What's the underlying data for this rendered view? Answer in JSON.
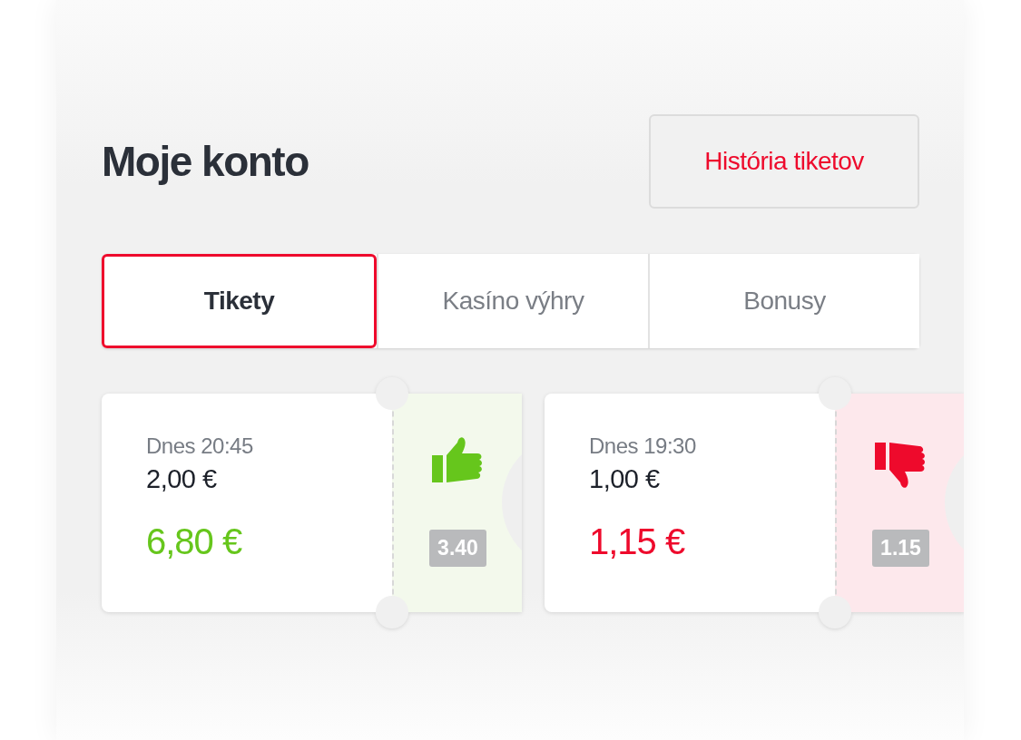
{
  "header": {
    "title": "Moje konto",
    "history_button": "História tiketov"
  },
  "tabs": [
    {
      "label": "Tikety",
      "selected": true
    },
    {
      "label": "Kasíno výhry",
      "selected": false
    },
    {
      "label": "Bonusy",
      "selected": false
    }
  ],
  "tickets": [
    {
      "date": "Dnes 20:45",
      "stake": "2,00 €",
      "payout": "6,80 €",
      "odds": "3.40",
      "kind": "won"
    },
    {
      "date": "Dnes 19:30",
      "stake": "1,00 €",
      "payout": "1,15 €",
      "odds": "1.15",
      "kind": "lost"
    }
  ]
}
